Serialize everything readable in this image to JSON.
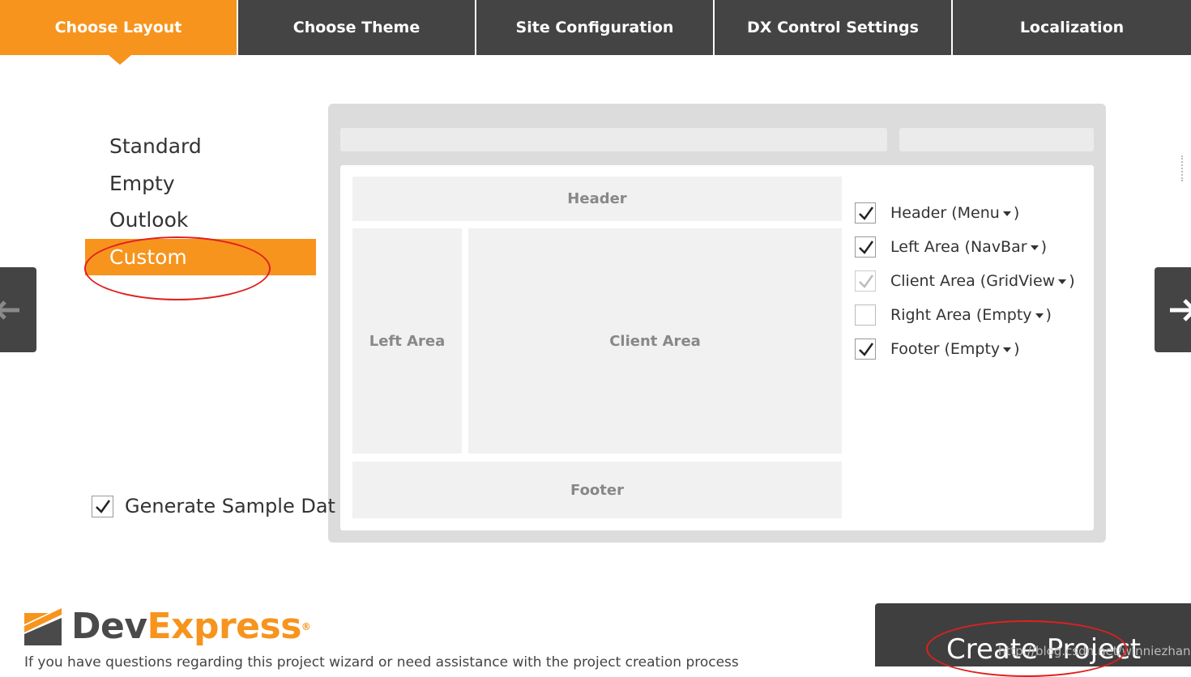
{
  "tabs": [
    {
      "label": "Choose Layout",
      "active": true
    },
    {
      "label": "Choose Theme"
    },
    {
      "label": "Site Configuration"
    },
    {
      "label": "DX Control Settings"
    },
    {
      "label": "Localization"
    }
  ],
  "layouts": [
    {
      "label": "Standard"
    },
    {
      "label": "Empty"
    },
    {
      "label": "Outlook"
    },
    {
      "label": "Custom",
      "selected": true
    }
  ],
  "preview": {
    "header": "Header",
    "left_area": "Left Area",
    "client_area": "Client Area",
    "footer": "Footer"
  },
  "options": [
    {
      "label": "Header (Menu",
      "close": ")",
      "checked": true,
      "state": "checked"
    },
    {
      "label": "Left Area (NavBar",
      "close": ")",
      "checked": true,
      "state": "checked"
    },
    {
      "label": "Client Area (GridView",
      "close": ")",
      "checked": true,
      "state": "disabled"
    },
    {
      "label": "Right Area (Empty",
      "close": ")",
      "checked": false,
      "state": "unchecked"
    },
    {
      "label": "Footer (Empty",
      "close": ")",
      "checked": true,
      "state": "checked"
    }
  ],
  "generate_sample": {
    "label": "Generate Sample Dat",
    "checked": true
  },
  "brand": {
    "dev": "Dev",
    "express": "Express",
    "reg": "®"
  },
  "help_text": "If you have questions regarding this project wizard or need assistance with the project creation process",
  "create_button": "Create Project",
  "watermark": "http://blog.csdn.net/winniezhang",
  "colors": {
    "accent": "#f7941d",
    "dark": "#3f3f3f",
    "annotation": "#e02020"
  }
}
